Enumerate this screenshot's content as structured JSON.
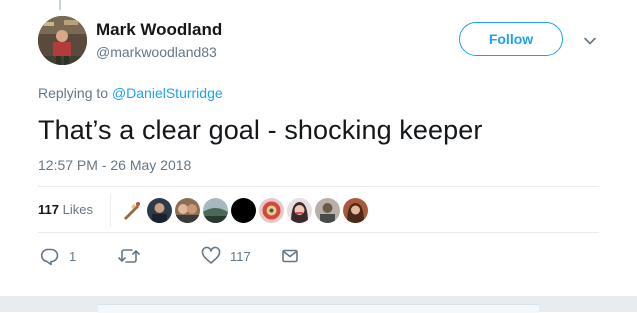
{
  "user": {
    "name": "Mark Woodland",
    "handle": "@markwoodland83"
  },
  "follow_label": "Follow",
  "reply": {
    "prefix": "Replying to",
    "mention": "@DanielSturridge"
  },
  "tweet": {
    "text": "That’s a clear goal - shocking keeper",
    "timestamp": "12:57 PM - 26 May 2018"
  },
  "stats": {
    "likes_number": "117",
    "likes_word": "Likes"
  },
  "actions": {
    "reply_count": "1",
    "retweet_count": "",
    "like_count": "117"
  },
  "colors": {
    "accent": "#1da1f2",
    "secondary_text": "#657786",
    "divider": "#e6ecf0"
  }
}
